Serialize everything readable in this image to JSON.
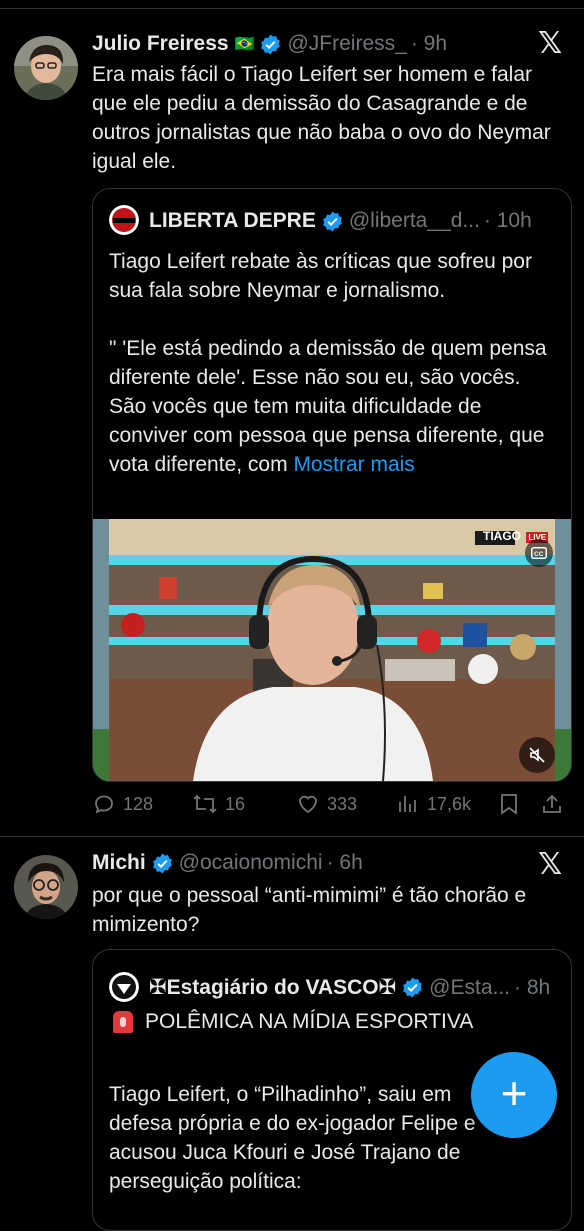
{
  "colors": {
    "accent": "#1d9bf0",
    "muted": "#71767b",
    "background": "#000000"
  },
  "posts": [
    {
      "author": "Julio Freiress",
      "flag": "🇧🇷",
      "handle": "@JFreiress_",
      "time": "· 9h",
      "text": "Era mais fácil o Tiago Leifert ser homem e falar que ele pediu a demissão do Casagrande e de outros jornalistas que não baba o ovo do Neymar igual ele.",
      "quote": {
        "author": "LIBERTA DEPRE",
        "handle": "@liberta__d...",
        "time": "· 10h",
        "text_1": "Tiago Leifert rebate às críticas que sofreu por sua fala sobre Neymar e jornalismo.",
        "text_2": "\" 'Ele está pedindo a demissão de quem pensa diferente dele'. Esse não sou eu, são vocês. São vocês que tem muita dificuldade de conviver com pessoa que pensa diferente, que vota diferente, com ",
        "show_more": "Mostrar mais",
        "video_badge": "TIAGO",
        "video_live": "LIVE"
      },
      "actions": {
        "replies": "128",
        "reposts": "16",
        "likes": "333",
        "views": "17,6k"
      }
    },
    {
      "author": "Michi",
      "handle": "@ocaionomichi",
      "time": "· 6h",
      "text": "por que o pessoal “anti-mimimi” é tão chorão e mimizento?",
      "quote": {
        "author": "✠Estagiário do VASCO✠",
        "handle": "@Esta...",
        "time": "· 8h",
        "line_1": "POLÊMICA NA MÍDIA ESPORTIVA",
        "text": "Tiago Leifert, o “Pilhadinho”, saiu em defesa própria e do ex-jogador Felipe e acusou Juca Kfouri e José Trajano de perseguição política:"
      }
    }
  ],
  "fab_label": "+"
}
